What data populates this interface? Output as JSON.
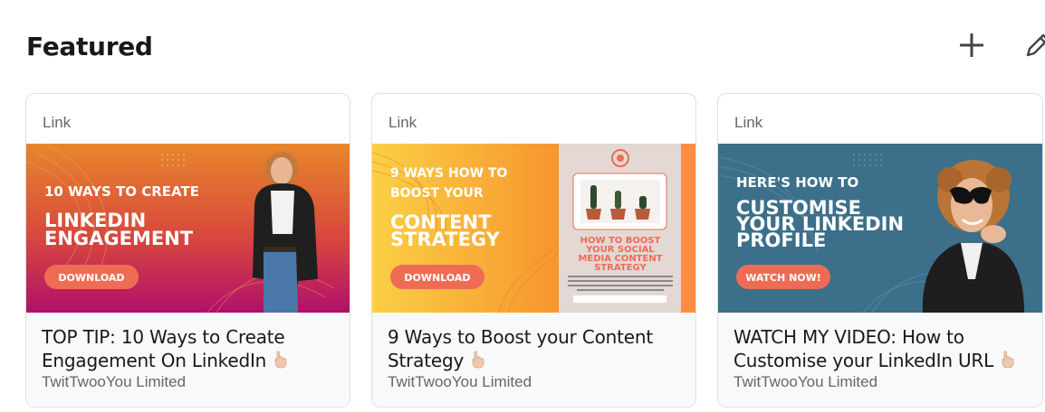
{
  "section": {
    "title": "Featured"
  },
  "actions": {
    "add_icon": "plus-icon",
    "edit_icon": "pencil-icon"
  },
  "cards": [
    {
      "kind": "Link",
      "title": "TOP TIP: 10 Ways to Create Engagement On LinkedIn",
      "author": "TwitTwooYou Limited",
      "image": {
        "kicker": "10 WAYS TO CREATE",
        "headline_1": "LINKEDIN",
        "headline_2": "ENGAGEMENT",
        "button": "DOWNLOAD"
      }
    },
    {
      "kind": "Link",
      "title": "9 Ways to Boost your Content Strategy",
      "author": "TwitTwooYou Limited",
      "image": {
        "kicker_1": "9 WAYS HOW TO",
        "kicker_2": "BOOST YOUR",
        "headline_1": "CONTENT",
        "headline_2": "STRATEGY",
        "button": "DOWNLOAD",
        "side_1": "HOW TO BOOST",
        "side_2": "YOUR SOCIAL",
        "side_3": "MEDIA CONTENT",
        "side_4": "STRATEGY"
      }
    },
    {
      "kind": "Link",
      "title": "WATCH MY VIDEO: How to Customise your LinkedIn URL",
      "author": "TwitTwooYou Limited",
      "image": {
        "kicker": "HERE'S HOW TO",
        "headline_1": "CUSTOMISE",
        "headline_2": "YOUR LINKEDIN",
        "headline_3": "PROFILE",
        "button": "WATCH NOW!"
      }
    }
  ],
  "colors": {
    "card1_top": "#e8862c",
    "card1_bottom": "#b0106a",
    "card2_left": "#f9b637",
    "card2_panel": "#e3d8d4",
    "card2_strip": "#ff8c41",
    "card3_bg": "#3c6f8a",
    "button": "#ee6c55"
  }
}
